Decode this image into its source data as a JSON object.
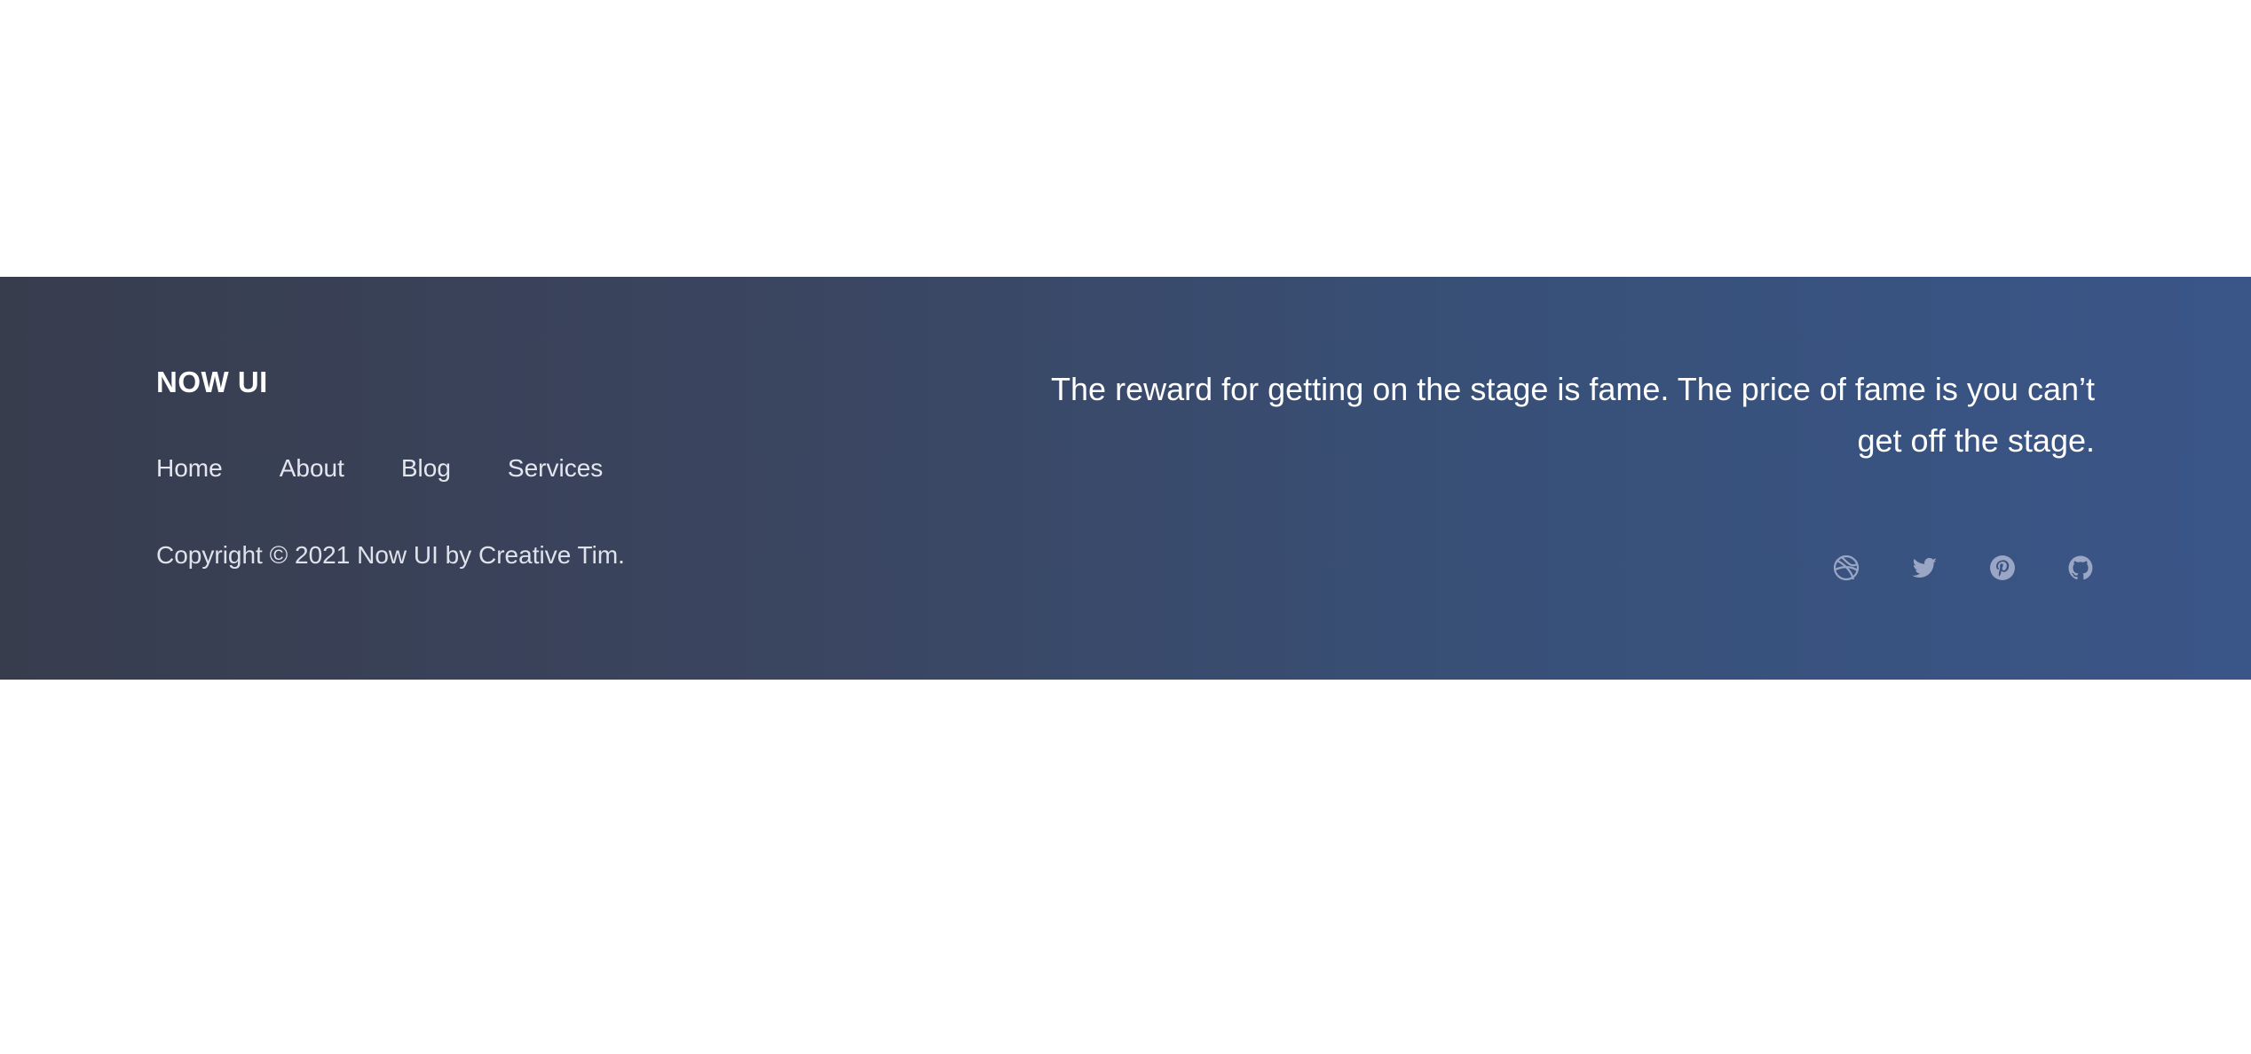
{
  "footer": {
    "brand": "NOW UI",
    "nav": [
      {
        "label": "Home"
      },
      {
        "label": "About"
      },
      {
        "label": "Blog"
      },
      {
        "label": "Services"
      }
    ],
    "copyright": "Copyright © 2021 Now UI by Creative Tim.",
    "quote": "The reward for getting on the stage is fame. The price of fame is you can’t get off the stage.",
    "socials": [
      {
        "icon": "dribbble-icon"
      },
      {
        "icon": "twitter-icon"
      },
      {
        "icon": "pinterest-icon"
      },
      {
        "icon": "github-icon"
      }
    ],
    "colors": {
      "gradient_start": "#383d4e",
      "gradient_end": "#3a5588",
      "icon": "#9aa6c4"
    }
  }
}
